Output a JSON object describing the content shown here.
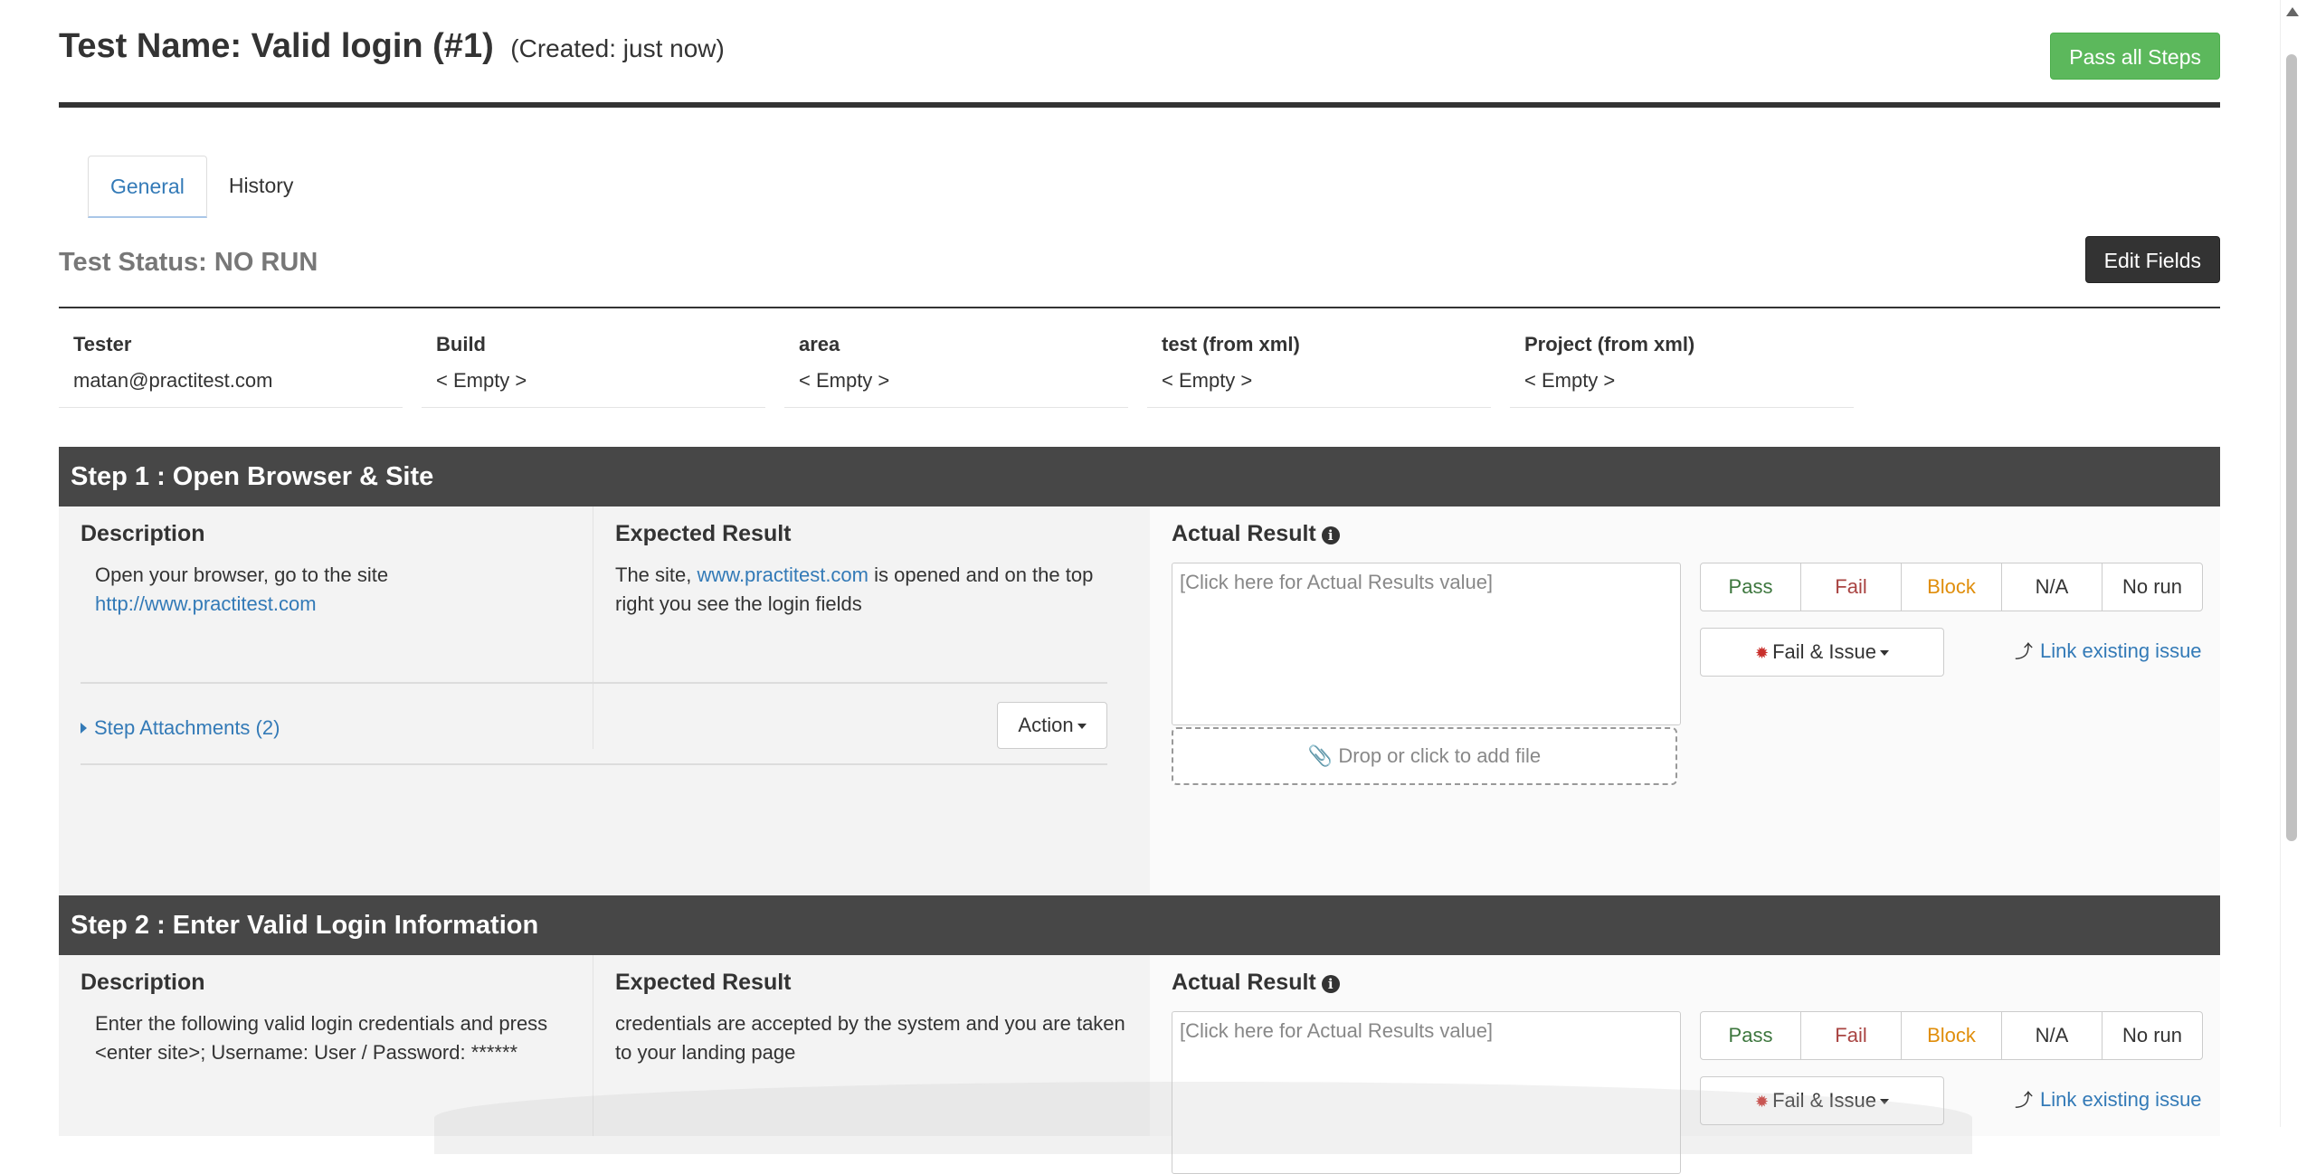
{
  "header": {
    "title": "Test Name: Valid login (#1)",
    "created": "(Created: just now)",
    "pass_all_label": "Pass all Steps"
  },
  "tabs": [
    {
      "label": "General",
      "active": true
    },
    {
      "label": "History",
      "active": false
    }
  ],
  "status": {
    "text": "Test Status: NO RUN",
    "edit_fields_label": "Edit Fields"
  },
  "fields": [
    {
      "label": "Tester",
      "value": "matan@practitest.com"
    },
    {
      "label": "Build",
      "value": "< Empty >"
    },
    {
      "label": "area",
      "value": "< Empty >"
    },
    {
      "label": "test (from xml)",
      "value": "< Empty >"
    },
    {
      "label": "Project (from xml)",
      "value": "< Empty >"
    }
  ],
  "labels": {
    "description": "Description",
    "expected": "Expected Result",
    "actual": "Actual Result",
    "actual_placeholder": "[Click here for Actual Results value]",
    "drop_file": "Drop or click to add file",
    "fail_issue": "Fail & Issue",
    "link_issue": "Link existing issue",
    "action": "Action",
    "pass": "Pass",
    "fail": "Fail",
    "block": "Block",
    "na": "N/A",
    "no_run": "No run"
  },
  "status_colors": {
    "pass": "#3c763d",
    "fail": "#a94442",
    "block": "#e08e0b",
    "na": "#333333",
    "no_run": "#333333"
  },
  "steps": [
    {
      "title": "Step 1 : Open Browser & Site",
      "description_text": "Open your browser, go to the site",
      "description_link": "http://www.practitest.com",
      "expected_pre": "The site,",
      "expected_link": "www.practitest.com",
      "expected_post": "is opened and on the top right you see the login fields",
      "attachments": "Step Attachments (2)"
    },
    {
      "title": "Step 2 : Enter Valid Login Information",
      "description_text": "Enter the following valid login credentials and press <enter site>; Username: User / Password: ******",
      "expected_text": "credentials are accepted by the system and you are taken to your landing page"
    }
  ]
}
